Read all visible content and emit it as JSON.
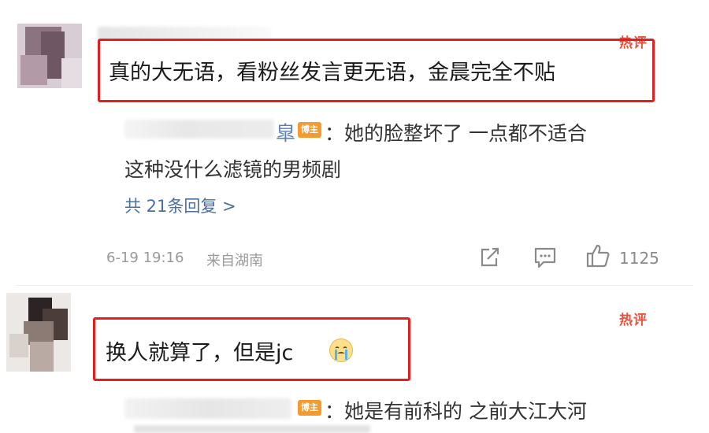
{
  "comment1": {
    "hot_label": "热评",
    "text": "真的大无语，看粉丝发言更无语，金晨完全不贴",
    "reply": {
      "author_suffix": "皐",
      "badge": "博主",
      "text_line1": "：她的脸整坏了 一点都不适合",
      "text_line2": "这种没什么滤镜的男频剧"
    },
    "replies_link": "共 21条回复 >",
    "date": "6-19 19:16",
    "location": "来自湖南",
    "like_count": "1125"
  },
  "comment2": {
    "hot_label": "热评",
    "text": "换人就算了，但是jc",
    "emoji": "crying-face-icon",
    "reply": {
      "badge": "博主",
      "text_line1": "：她是有前科的 之前大江大河"
    }
  },
  "colors": {
    "highlight_box": "#e02020",
    "hot_label": "#e8533f",
    "link": "#4a6ea3",
    "badge": "#f59a2e"
  }
}
